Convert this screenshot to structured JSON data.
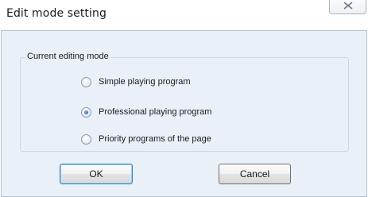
{
  "window": {
    "title": "Edit mode setting"
  },
  "group": {
    "title": "Current editing mode",
    "options": [
      {
        "label": "Simple playing program",
        "checked": false
      },
      {
        "label": "Professional playing program",
        "checked": true
      },
      {
        "label": "Priority programs of the page",
        "checked": false
      }
    ]
  },
  "buttons": {
    "ok_label": "OK",
    "cancel_label": "Cancel"
  },
  "icons": {
    "close": "close-icon"
  },
  "colors": {
    "client_background": "#e9f0f8",
    "radio_dot": "#2a6fd0",
    "default_button_border": "#3c7fb1"
  }
}
